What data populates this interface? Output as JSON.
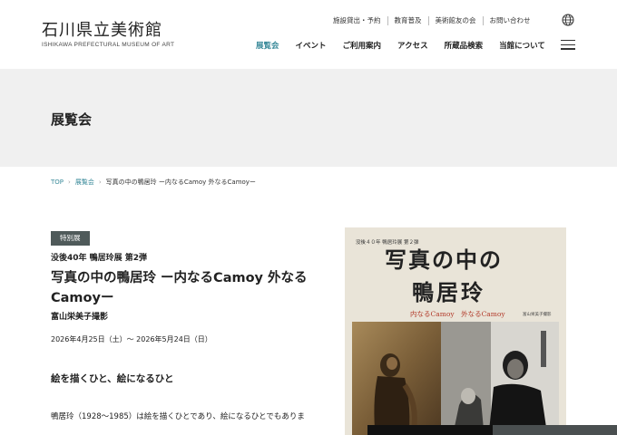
{
  "header": {
    "logo_jp": "石川県立美術館",
    "logo_en": "ISHIKAWA PREFECTURAL MUSEUM OF ART",
    "util_nav": [
      "施設貸出・予約",
      "教育普及",
      "美術館友の会",
      "お問い合わせ"
    ],
    "main_nav": [
      "展覧会",
      "イベント",
      "ご利用案内",
      "アクセス",
      "所蔵品検索",
      "当館について"
    ],
    "active_nav": "展覧会",
    "accent_color": "#3a8a9a"
  },
  "page": {
    "title": "展覧会"
  },
  "breadcrumb": {
    "items": [
      "TOP",
      "展覧会",
      "写真の中の鴨居玲 ー内なるCamoy 外なるCamoyー"
    ]
  },
  "exhibition": {
    "badge": "特別展",
    "subtitle": "没後40年 鴨居玲展 第2弾",
    "title": "写真の中の鴨居玲 ー内なるCamoy 外なるCamoyー",
    "photographer": "富山栄美子撮影",
    "dates": "2026年4月25日（土）〜 2026年5月24日（日）",
    "section_heading": "絵を描くひと、絵になるひと",
    "body": "鴨居玲（1928〜1985）は絵を描くひとであり、絵になるひとでもありま"
  },
  "poster": {
    "top_text": "没後４０年 鴨居玲展 第２弾",
    "title_line1": "写真の中の",
    "title_line2": "鴨居玲",
    "sub_text": "内なるCamoy　外なるCamoy",
    "photographer": "富山栄美子撮影"
  }
}
